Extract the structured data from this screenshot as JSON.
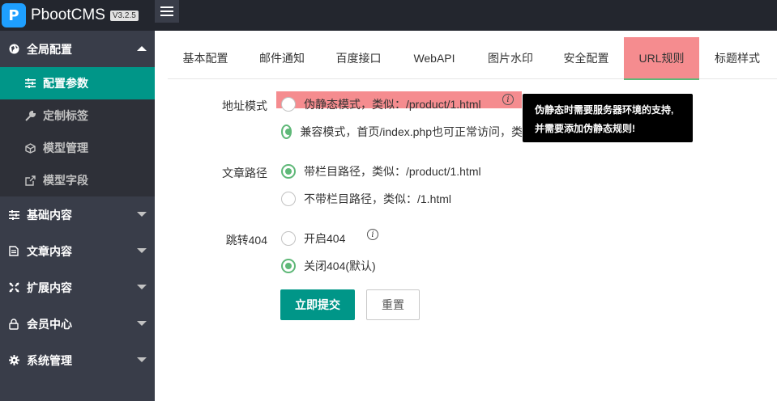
{
  "app": {
    "logo_letter": "P",
    "name": "PbootCMS",
    "version": "V3.2.5"
  },
  "sidebar": {
    "groups": [
      {
        "label": "全局配置",
        "icon": "globe-icon",
        "expanded": true
      },
      {
        "label": "基础内容",
        "icon": "sliders-icon"
      },
      {
        "label": "文章内容",
        "icon": "file-icon"
      },
      {
        "label": "扩展内容",
        "icon": "expand-icon"
      },
      {
        "label": "会员中心",
        "icon": "lock-icon"
      },
      {
        "label": "系统管理",
        "icon": "gear-icon"
      }
    ],
    "sub_items": [
      {
        "label": "配置参数",
        "icon": "sliders-icon",
        "active": true
      },
      {
        "label": "定制标签",
        "icon": "wrench-icon"
      },
      {
        "label": "模型管理",
        "icon": "cube-icon"
      },
      {
        "label": "模型字段",
        "icon": "external-link-icon"
      }
    ]
  },
  "tabs": [
    "基本配置",
    "邮件通知",
    "百度接口",
    "WebAPI",
    "图片水印",
    "安全配置",
    "URL规则",
    "标题样式"
  ],
  "active_tab": "URL规则",
  "form": {
    "url_mode": {
      "label": "地址模式",
      "options": [
        "伪静态模式，类似：/product/1.html",
        "兼容模式，首页/index.php也可正常访问，类"
      ],
      "selected": 1
    },
    "article_path": {
      "label": "文章路径",
      "options": [
        "带栏目路径，类似：/product/1.html",
        "不带栏目路径，类似：/1.html"
      ],
      "selected": 0
    },
    "redirect_404": {
      "label": "跳转404",
      "options": [
        "开启404",
        "关闭404(默认)"
      ],
      "selected": 1
    },
    "info_glyph": "i",
    "tooltip": {
      "line1": "伪静态时需要服务器环境的支持,",
      "line2": "并需要添加伪静态规则!"
    },
    "submit_label": "立即提交",
    "reset_label": "重置"
  },
  "colors": {
    "accent": "#009688",
    "radio_checked": "#5fb878",
    "highlight": "#f58c8f",
    "sidebar_bg": "#393d49",
    "topbar_bg": "#23262e"
  }
}
